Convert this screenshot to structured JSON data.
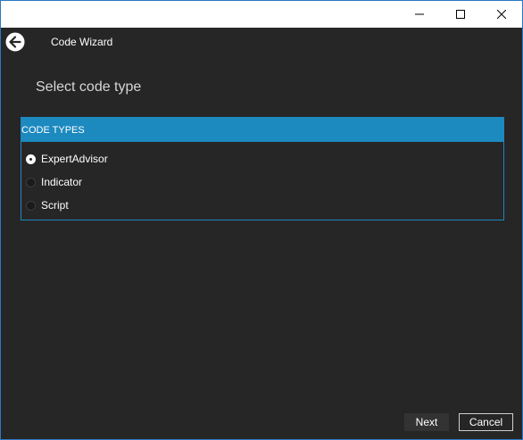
{
  "window": {
    "controls": {
      "minimize_icon": "minimize-icon",
      "maximize_icon": "maximize-icon",
      "close_icon": "close-icon"
    }
  },
  "header": {
    "back_icon": "back-arrow-icon",
    "title": "Code Wizard"
  },
  "page": {
    "heading": "Select code type"
  },
  "code_types": {
    "header": "CODE TYPES",
    "options": [
      {
        "label": "ExpertAdvisor",
        "checked": true
      },
      {
        "label": "Indicator",
        "checked": false
      },
      {
        "label": "Script",
        "checked": false
      }
    ]
  },
  "footer": {
    "next_label": "Next",
    "cancel_label": "Cancel"
  },
  "colors": {
    "background": "#262626",
    "accent": "#1c89bf",
    "text": "#ffffff"
  }
}
